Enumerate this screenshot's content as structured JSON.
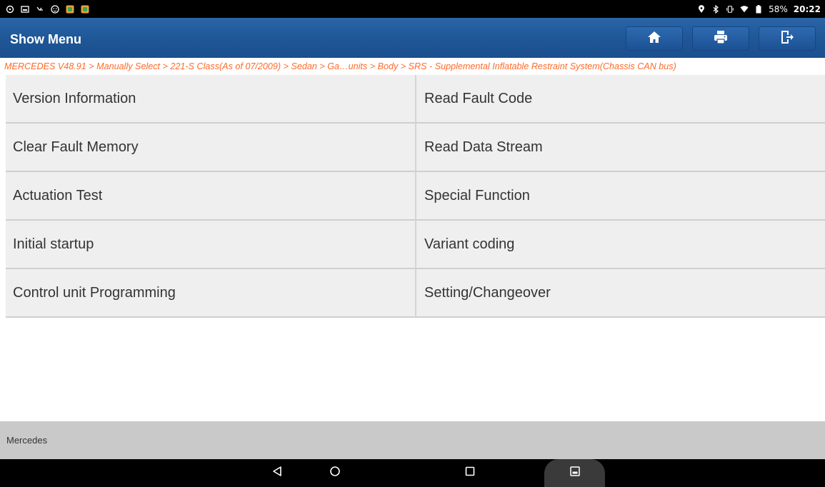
{
  "status_bar": {
    "left_icons": [
      "dvd-icon",
      "screenshot-icon",
      "usb-icon",
      "face-icon",
      "app-icon-1",
      "app-icon-2"
    ],
    "right_icons": [
      "location-icon",
      "bluetooth-icon",
      "vibrate-icon",
      "wifi-icon",
      "battery-icon"
    ],
    "battery": "58%",
    "time": "20:22"
  },
  "header": {
    "title": "Show Menu",
    "buttons": [
      "home-icon",
      "print-icon",
      "exit-icon"
    ],
    "color": "#1e5696"
  },
  "breadcrumb": {
    "text": "MERCEDES V48.91 > Manually Select > 221-S Class(As of 07/2009) > Sedan > Ga…units > Body > SRS - Supplemental Inflatable Restraint System(Chassis CAN bus)",
    "color": "#ff6a2b"
  },
  "menu": {
    "items": [
      "Version Information",
      "Read Fault Code",
      "Clear Fault Memory",
      "Read Data Stream",
      "Actuation Test",
      "Special Function",
      "Initial startup",
      "Variant coding",
      "Control unit Programming",
      "Setting/Changeover"
    ]
  },
  "footer": {
    "label": "Mercedes"
  },
  "nav_bar": {
    "buttons": [
      "back-icon",
      "home-circle-icon",
      "recents-icon",
      "screenshot-pill-icon"
    ]
  }
}
